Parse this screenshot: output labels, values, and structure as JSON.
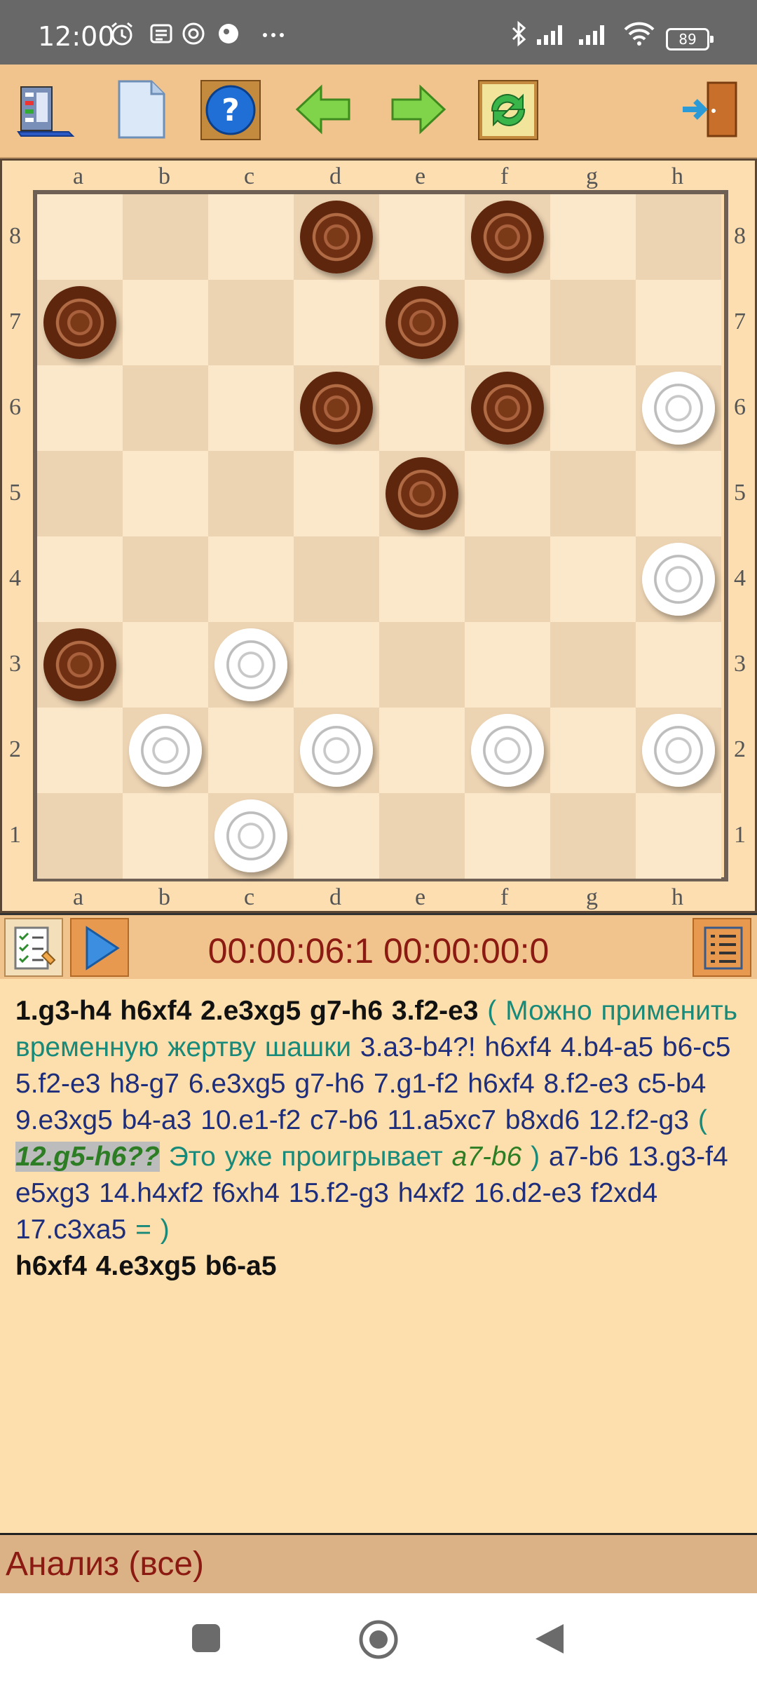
{
  "status_bar": {
    "time": "12:00",
    "battery": "89",
    "left_icons": [
      "alarm-icon",
      "message-icon",
      "at-icon",
      "record-icon",
      "more-dots-icon"
    ],
    "right_icons": [
      "bluetooth-icon",
      "signal-icon",
      "signal-icon",
      "wifi-icon",
      "battery-icon"
    ]
  },
  "toolbar": {
    "buttons": [
      "database-icon",
      "new-file-icon",
      "help-icon",
      "back-arrow-icon",
      "forward-arrow-icon",
      "flip-board-icon",
      "exit-door-icon"
    ]
  },
  "board": {
    "files": [
      "a",
      "b",
      "c",
      "d",
      "e",
      "f",
      "g",
      "h"
    ],
    "ranks": [
      "8",
      "7",
      "6",
      "5",
      "4",
      "3",
      "2",
      "1"
    ],
    "black_pieces": [
      "d8",
      "f8",
      "a7",
      "e7",
      "d6",
      "f6",
      "e5",
      "a3"
    ],
    "white_pieces": [
      "h6",
      "h4",
      "c3",
      "b2",
      "d2",
      "f2",
      "h2",
      "c1"
    ],
    "colors": {
      "light": "#fbe8cb",
      "dark": "#ecd3b2",
      "frame": "#6e6055"
    }
  },
  "control_bar": {
    "clock": "00:00:06:1 00:00:00:0"
  },
  "notation": {
    "main_start": "1.g3-h4 h6xf4 2.e3xg5 g7-h6 3.f2-e3",
    "open_paren": "(",
    "comment1": "Можно применить временную жертву шашки",
    "var1": "3.a3-b4?! h6xf4 4.b4-a5 b6-c5 5.f2-e3 h8-g7 6.e3xg5 g7-h6 7.g1-f2 h6xf4 8.f2-e3 c5-b4 9.e3xg5 b4-a3 10.e1-f2 c7-b6 11.a5xc7 b8xd6 12.f2-g3",
    "inner_open": "(",
    "highlight": "12.g5-h6??",
    "comment2": "Это уже проигрывает",
    "alt": "a7-b6",
    "inner_close": ")",
    "var2": "a7-b6 13.g3-f4 e5xg3 14.h4xf2 f6xh4 15.f2-g3 h4xf2 16.d2-e3 f2xd4 17.c3xa5",
    "eq": "=",
    "close_paren": ")",
    "main_end": "h6xf4 4.e3xg5 b6-a5"
  },
  "footer": {
    "label": "Анализ (все)"
  },
  "nav_bar": {
    "buttons": [
      "recents-square-icon",
      "home-circle-icon",
      "back-triangle-icon"
    ]
  }
}
